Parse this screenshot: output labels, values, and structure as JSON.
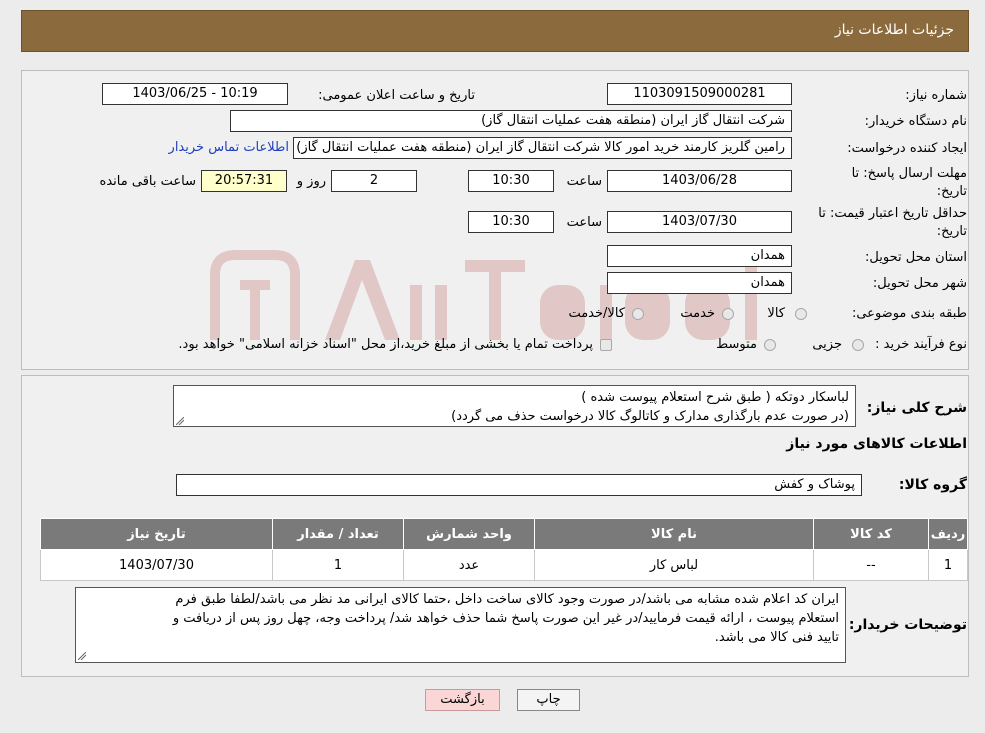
{
  "header": {
    "title": "جزئیات اطلاعات نیاز"
  },
  "fields": {
    "need_number_label": "شماره نیاز:",
    "need_number": "1103091509000281",
    "announce_label": "تاریخ و ساعت اعلان عمومی:",
    "announce_value": "1403/06/25 - 10:19",
    "buyer_org_label": "نام دستگاه خریدار:",
    "buyer_org": "شرکت انتقال گاز ایران (منطقه هفت عملیات انتقال گاز)",
    "creator_label": "ایجاد کننده درخواست:",
    "creator": "رامین گلریز کارمند خرید امور کالا شرکت انتقال گاز ایران (منطقه هفت عملیات انتقال گاز)",
    "contact_link": "اطلاعات تماس خریدار",
    "deadline_label_1": "مهلت ارسال پاسخ: تا",
    "deadline_label_2": "تاریخ:",
    "deadline_date": "1403/06/28",
    "time_label": "ساعت",
    "deadline_time": "10:30",
    "days_count": "2",
    "days_label": "روز و",
    "remaining_time": "20:57:31",
    "remaining_label": "ساعت باقی مانده",
    "validity_label_1": "حداقل تاریخ اعتبار قیمت: تا",
    "validity_label_2": "تاریخ:",
    "validity_date": "1403/07/30",
    "validity_time": "10:30",
    "province_label": "استان محل تحویل:",
    "province": "همدان",
    "city_label": "شهر محل تحویل:",
    "city": "همدان",
    "category_label": "طبقه بندی موضوعی:",
    "category_options": [
      "کالا",
      "خدمت",
      "کالا/خدمت"
    ],
    "process_label": "نوع فرآیند خرید :",
    "process_options": [
      "جزیی",
      "متوسط"
    ],
    "payment_note": "پرداخت تمام یا بخشی از مبلغ خرید،از محل \"اسناد خزانه اسلامی\" خواهد بود."
  },
  "description": {
    "label": "شرح کلی نیاز:",
    "line1": "لباسکار دوتکه ( طبق شرح استعلام پیوست شده )",
    "line2": "(در صورت عدم بارگذاری مدارک و کاتالوگ کالا درخواست حذف می گردد)"
  },
  "goods": {
    "section_title": "اطلاعات کالاهای مورد نیاز",
    "group_label": "گروه کالا:",
    "group_value": "پوشاک و کفش",
    "columns": [
      "ردیف",
      "کد کالا",
      "نام کالا",
      "واحد شمارش",
      "تعداد / مقدار",
      "تاریخ نیاز"
    ],
    "rows": [
      [
        "1",
        "--",
        "لباس کار",
        "عدد",
        "1",
        "1403/07/30"
      ]
    ]
  },
  "buyer_notes": {
    "label": "توضیحات خریدار:",
    "line1": "ایران کد اعلام شده مشابه می باشد/در صورت وجود کالای ساخت داخل ،حتما کالای ایرانی مد نظر می باشد/لطفا طبق فرم",
    "line2": "استعلام پیوست ، ارائه قیمت فرمایید/در غیر این صورت پاسخ شما حذف خواهد شد/ پرداخت وجه، چهل روز پس از دریافت و",
    "line3": "تایید فنی کالا می باشد."
  },
  "buttons": {
    "print": "چاپ",
    "back": "بازگشت"
  },
  "colors": {
    "header_bg": "#8b6b3d",
    "table_header_bg": "#7a7a7a",
    "back_button_bg": "#fbd6d6",
    "link": "#1f3fbf"
  }
}
